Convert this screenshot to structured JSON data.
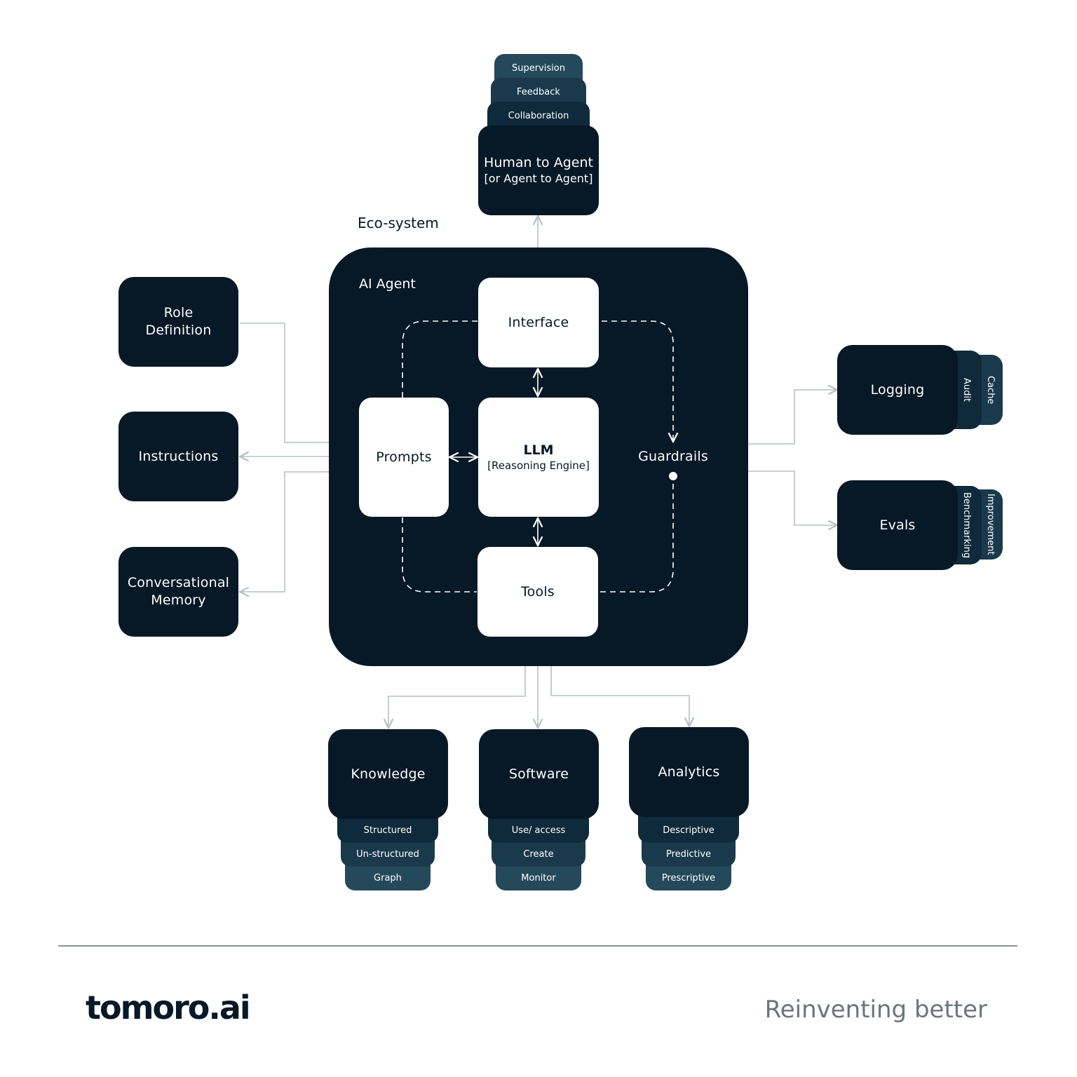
{
  "ecosystem_label": "Eco-system",
  "agent": {
    "title": "AI Agent",
    "interface": "Interface",
    "prompts": "Prompts",
    "llm_title": "LLM",
    "llm_subtitle": "[Reasoning Engine]",
    "tools": "Tools",
    "guardrails": "Guardrails"
  },
  "human": {
    "title_line1": "Human to Agent",
    "title_line2": "[or Agent to Agent]",
    "layers": [
      "Supervision",
      "Feedback",
      "Collaboration"
    ]
  },
  "left_inputs": [
    {
      "line1": "Role",
      "line2": "Definition"
    },
    {
      "line1": "Instructions",
      "line2": ""
    },
    {
      "line1": "Conversational",
      "line2": "Memory"
    }
  ],
  "right_outputs": [
    {
      "title": "Logging",
      "tabs": [
        "Audit",
        "Cache"
      ]
    },
    {
      "title": "Evals",
      "tabs": [
        "Benchmarking",
        "Improvement"
      ]
    }
  ],
  "bottom_resources": [
    {
      "title": "Knowledge",
      "layers": [
        "Structured",
        "Un-structured",
        "Graph"
      ]
    },
    {
      "title": "Software",
      "layers": [
        "Use/ access",
        "Create",
        "Monitor"
      ]
    },
    {
      "title": "Analytics",
      "layers": [
        "Descriptive",
        "Predictive",
        "Prescriptive"
      ]
    }
  ],
  "footer": {
    "logo": "tomoro.ai",
    "tagline": "Reinventing better"
  },
  "colors": {
    "navy": "#071827",
    "layer_1": "#0f2a3a",
    "layer_2": "#1a3a4c",
    "layer_3": "#24495b",
    "connector": "#b9bfc4",
    "tagline": "#6c757b"
  }
}
